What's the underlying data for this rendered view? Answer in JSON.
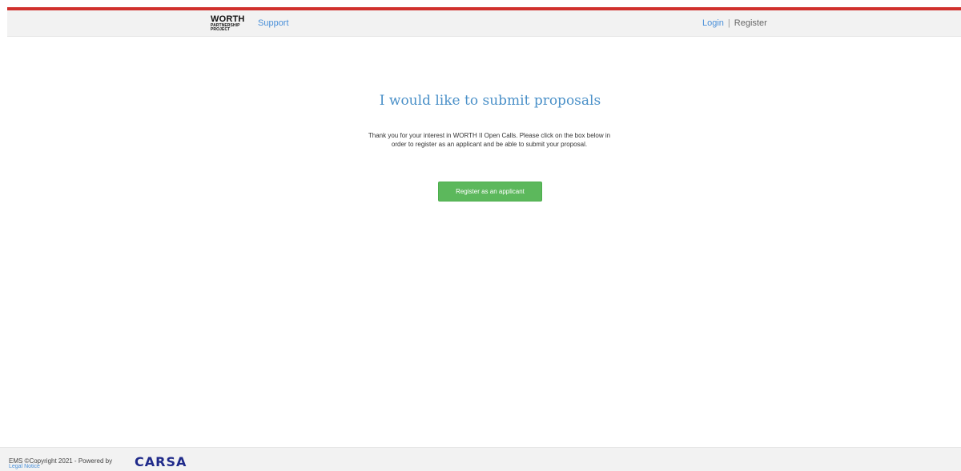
{
  "brand": {
    "accent_color": "#d0302c",
    "link_color": "#4a90d9",
    "button_color": "#5cb85c",
    "logo": {
      "line1": "WORTH",
      "line2": "PARTNERSHIP",
      "line3": "PROJECT"
    }
  },
  "nav": {
    "support": "Support",
    "login": "Login",
    "separator": "|",
    "register": "Register"
  },
  "main": {
    "title": "I would like to submit proposals",
    "lead": "Thank you for your interest in WORTH II Open Calls. Please click on the box below in order to register as an applicant and be able to submit your proposal.",
    "cta": "Register as an applicant"
  },
  "footer": {
    "copyright": "EMS ©Copyright 2021 - Powered by",
    "powered_by": "CARSA",
    "legal": "Legal Notice"
  }
}
